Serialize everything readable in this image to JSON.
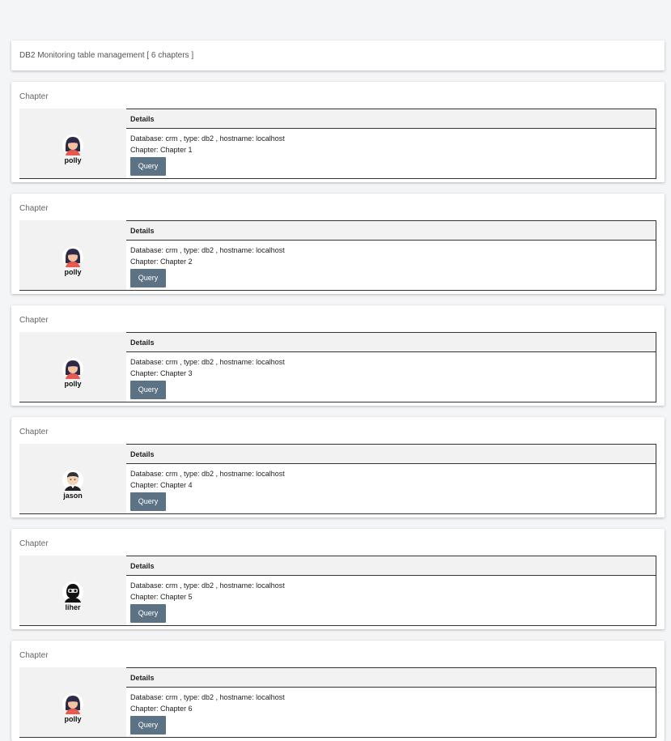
{
  "page": {
    "header": "DB2 Monitoring table management [ 6 chapters ]"
  },
  "chapter_label": "Chapter",
  "details_label": "Details",
  "query_label": "Query",
  "chapters": [
    {
      "user": "polly",
      "avatar": "female-avatar-icon",
      "line1": "Database: crm , type: db2 , hostname: localhost",
      "line2": "Chapter: Chapter 1"
    },
    {
      "user": "polly",
      "avatar": "female-avatar-icon",
      "line1": "Database: crm , type: db2 , hostname: localhost",
      "line2": "Chapter: Chapter 2"
    },
    {
      "user": "polly",
      "avatar": "female-avatar-icon",
      "line1": "Database: crm , type: db2 , hostname: localhost",
      "line2": "Chapter: Chapter 3"
    },
    {
      "user": "jason",
      "avatar": "male-avatar-icon",
      "line1": "Database: crm , type: db2 , hostname: localhost",
      "line2": "Chapter: Chapter 4"
    },
    {
      "user": "liher",
      "avatar": "masked-avatar-icon",
      "line1": "Database: crm , type: db2 , hostname: localhost",
      "line2": "Chapter: Chapter 5"
    },
    {
      "user": "polly",
      "avatar": "female-avatar-icon",
      "line1": "Database: crm , type: db2 , hostname: localhost",
      "line2": "Chapter: Chapter 6"
    }
  ],
  "colors": {
    "button": "#5b7384",
    "background": "#f4f5f7"
  }
}
